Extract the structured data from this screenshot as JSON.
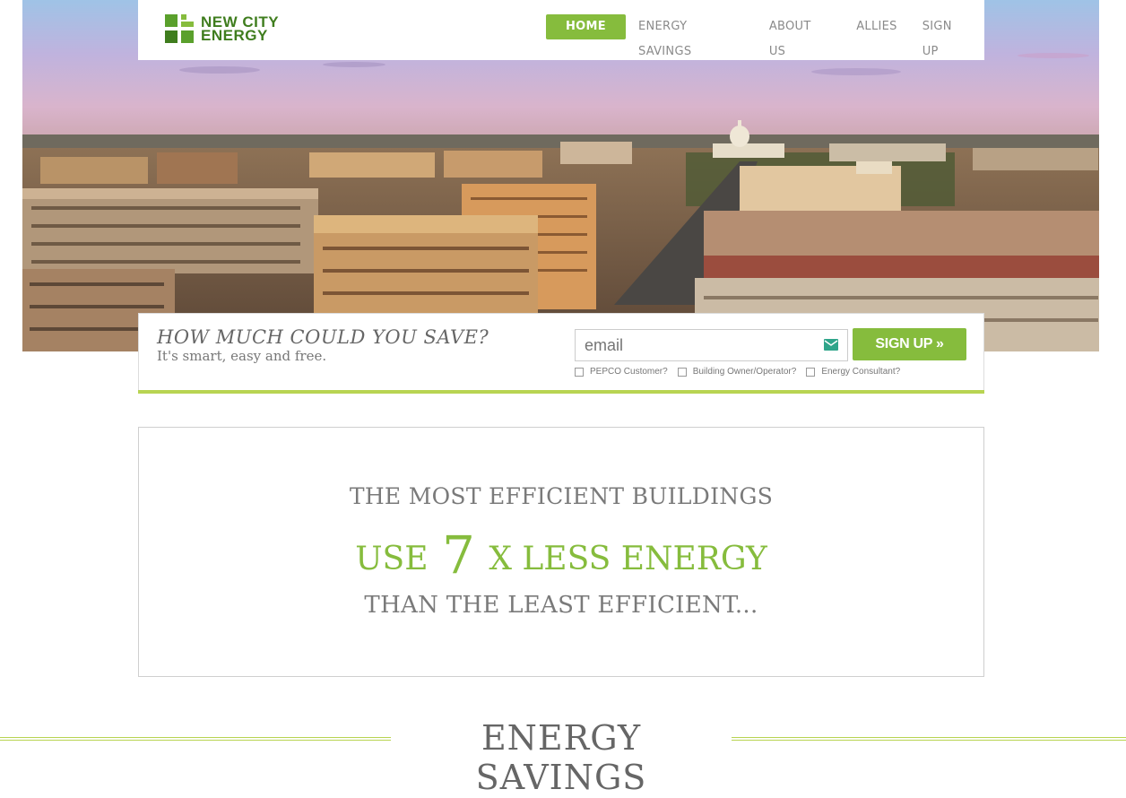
{
  "brand": {
    "line1": "NEW CITY",
    "line2": "ENERGY",
    "color": "#5aa02c"
  },
  "nav": {
    "items": [
      {
        "label": "HOME",
        "active": true
      },
      {
        "label": "ENERGY SAVINGS",
        "active": false
      },
      {
        "label": "ABOUT US",
        "active": false
      },
      {
        "label": "ALLIES",
        "active": false
      },
      {
        "label": "SIGN UP",
        "active": false
      }
    ],
    "active_color": "#86bc3d"
  },
  "signup": {
    "question": "HOW MUCH COULD YOU SAVE?",
    "subtitle": "It's smart, easy and free.",
    "email_placeholder": "email",
    "button": "SIGN UP »",
    "checkboxes": [
      "PEPCO Customer?",
      "Building Owner/Operator?",
      "Energy Consultant?"
    ]
  },
  "stat": {
    "line1": "THE MOST EFFICIENT BUILDINGS",
    "line2_prefix": "USE",
    "line2_number": "7",
    "line2_suffix": "X LESS ENERGY",
    "line3": "THAN THE LEAST EFFICIENT..."
  },
  "section": {
    "title": "ENERGY SAVINGS"
  },
  "colors": {
    "accent_green": "#86bc3d",
    "line_green": "#b8d452",
    "text_gray": "#7a7a7a"
  }
}
